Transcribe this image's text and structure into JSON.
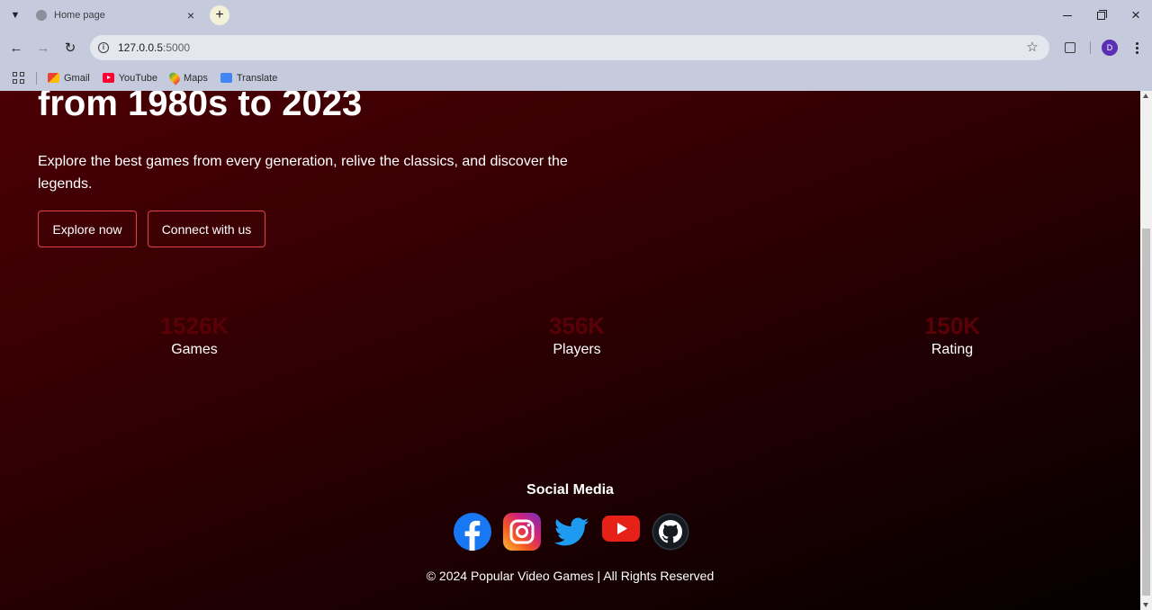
{
  "browser": {
    "tab": {
      "title": "Home page"
    },
    "url": {
      "host": "127.0.0.5",
      "port": ":5000"
    },
    "profile_initial": "D",
    "bookmarks": [
      {
        "label": "Gmail",
        "icon": "gmail-icon"
      },
      {
        "label": "YouTube",
        "icon": "youtube-icon"
      },
      {
        "label": "Maps",
        "icon": "maps-icon"
      },
      {
        "label": "Translate",
        "icon": "translate-icon"
      }
    ]
  },
  "hero": {
    "title": "from 1980s to 2023",
    "text": "Explore the best games from every generation, relive the classics, and discover the legends.",
    "explore_label": "Explore now",
    "connect_label": "Connect with us"
  },
  "stats": [
    {
      "value": "1526K",
      "label": "Games"
    },
    {
      "value": "356K",
      "label": "Players"
    },
    {
      "value": "150K",
      "label": "Rating"
    }
  ],
  "social": {
    "title": "Social Media",
    "icons": [
      "facebook-icon",
      "instagram-icon",
      "twitter-icon",
      "youtube-icon",
      "github-icon"
    ]
  },
  "footer": {
    "text": "© 2024 Popular Video Games | All Rights Reserved"
  },
  "colors": {
    "accent_border": "#e0444b",
    "stat_number": "#5a0007",
    "background_top": "#4a0004",
    "background_bottom": "#050000"
  }
}
